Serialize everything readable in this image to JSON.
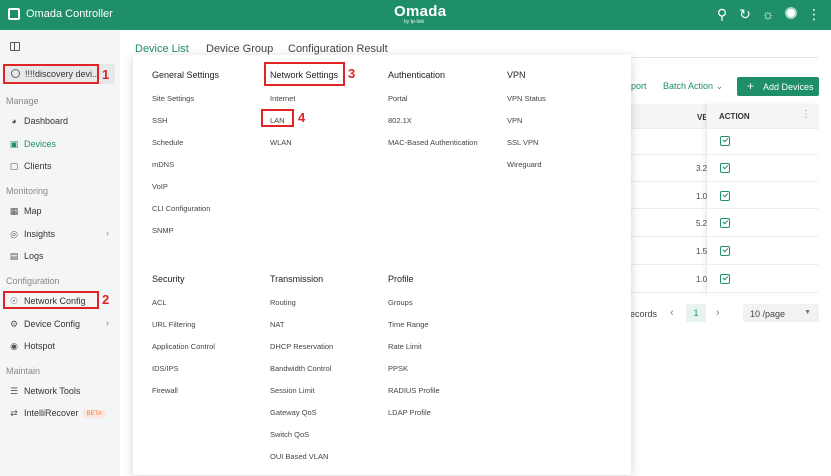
{
  "topbar": {
    "app_title": "Omada Controller",
    "brand": "Omada",
    "brand_sub": "by tp-link",
    "icons": [
      "search-icon",
      "refresh-icon",
      "theme-icon",
      "avatar",
      "more-icon"
    ],
    "color": "#1e8e6b"
  },
  "sidebar": {
    "site": "!!!!discovery devi...",
    "sections": {
      "manage": "Manage",
      "monitoring": "Monitoring",
      "configuration": "Configuration",
      "maintain": "Maintain"
    },
    "items": {
      "dashboard": "Dashboard",
      "devices": "Devices",
      "clients": "Clients",
      "map": "Map",
      "insights": "Insights",
      "logs": "Logs",
      "network_config": "Network Config",
      "device_config": "Device Config",
      "hotspot": "Hotspot",
      "network_tools": "Network Tools",
      "intellirecover": "IntelliRecover",
      "beta": "BETA"
    }
  },
  "main": {
    "tabs": [
      "Device List",
      "Device Group",
      "Configuration Result"
    ],
    "toolbar": {
      "export": "port",
      "batch_action": "Batch Action",
      "add_devices": "Add Devices"
    },
    "table": {
      "col_ve": "VE",
      "action": "ACTION",
      "versions": [
        "3.2",
        "1.0",
        "5.2",
        "1.5",
        "1.0"
      ]
    },
    "pagination": {
      "records": "ecords",
      "current": "1",
      "page_size": "10 /page"
    }
  },
  "menu": {
    "general": {
      "title": "General Settings",
      "items": [
        "Site Settings",
        "SSH",
        "Schedule",
        "mDNS",
        "VoIP",
        "CLI Configuration",
        "SNMP"
      ]
    },
    "network": {
      "title": "Network Settings",
      "items": [
        "Internet",
        "LAN",
        "WLAN"
      ]
    },
    "authentication": {
      "title": "Authentication",
      "items": [
        "Portal",
        "802.1X",
        "MAC-Based Authentication"
      ]
    },
    "vpn": {
      "title": "VPN",
      "items": [
        "VPN Status",
        "VPN",
        "SSL VPN",
        "Wireguard"
      ]
    },
    "security": {
      "title": "Security",
      "items": [
        "ACL",
        "URL Filtering",
        "Application Control",
        "IDS/IPS",
        "Firewall"
      ]
    },
    "transmission": {
      "title": "Transmission",
      "items": [
        "Routing",
        "NAT",
        "DHCP Reservation",
        "Bandwidth Control",
        "Session Limit",
        "Gateway QoS",
        "Switch QoS",
        "OUI Based VLAN"
      ]
    },
    "profile": {
      "title": "Profile",
      "items": [
        "Groups",
        "Time Range",
        "Rate Limit",
        "PPSK",
        "RADIUS Profile",
        "LDAP Profile"
      ]
    }
  },
  "annotations": [
    "1",
    "2",
    "3",
    "4"
  ]
}
